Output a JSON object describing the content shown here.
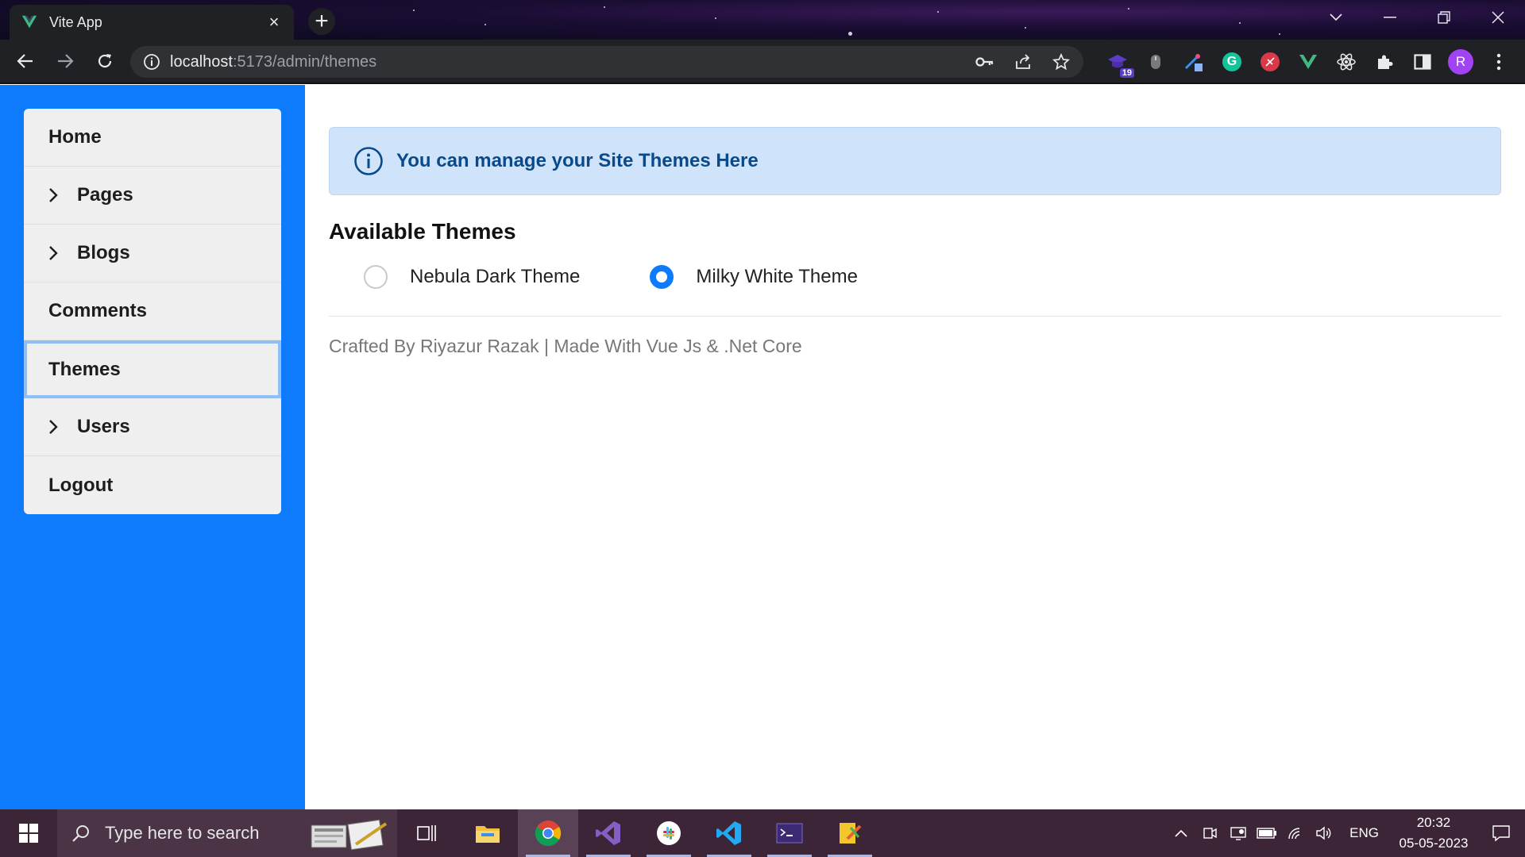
{
  "browser": {
    "tab_title": "Vite App",
    "url_host": "localhost",
    "url_path": ":5173/admin/themes",
    "extension_badge": "19",
    "profile_initial": "R"
  },
  "sidebar": {
    "items": [
      {
        "label": "Home",
        "expandable": false,
        "active": false
      },
      {
        "label": "Pages",
        "expandable": true,
        "active": false
      },
      {
        "label": "Blogs",
        "expandable": true,
        "active": false
      },
      {
        "label": "Comments",
        "expandable": false,
        "active": false
      },
      {
        "label": "Themes",
        "expandable": false,
        "active": true
      },
      {
        "label": "Users",
        "expandable": true,
        "active": false
      },
      {
        "label": "Logout",
        "expandable": false,
        "active": false
      }
    ]
  },
  "main": {
    "alert_text": "You can manage your Site Themes Here",
    "section_title": "Available Themes",
    "themes": [
      {
        "label": "Nebula Dark Theme",
        "selected": false
      },
      {
        "label": "Milky White Theme",
        "selected": true
      }
    ],
    "footer": "Crafted By Riyazur Razak | Made With Vue Js & .Net Core"
  },
  "taskbar": {
    "search_placeholder": "Type here to search",
    "language": "ENG",
    "time": "20:32",
    "date": "05-05-2023"
  },
  "colors": {
    "sidebar_bg": "#0d7bfc",
    "alert_bg": "#cfe4fb",
    "alert_text": "#0a4a8a"
  }
}
